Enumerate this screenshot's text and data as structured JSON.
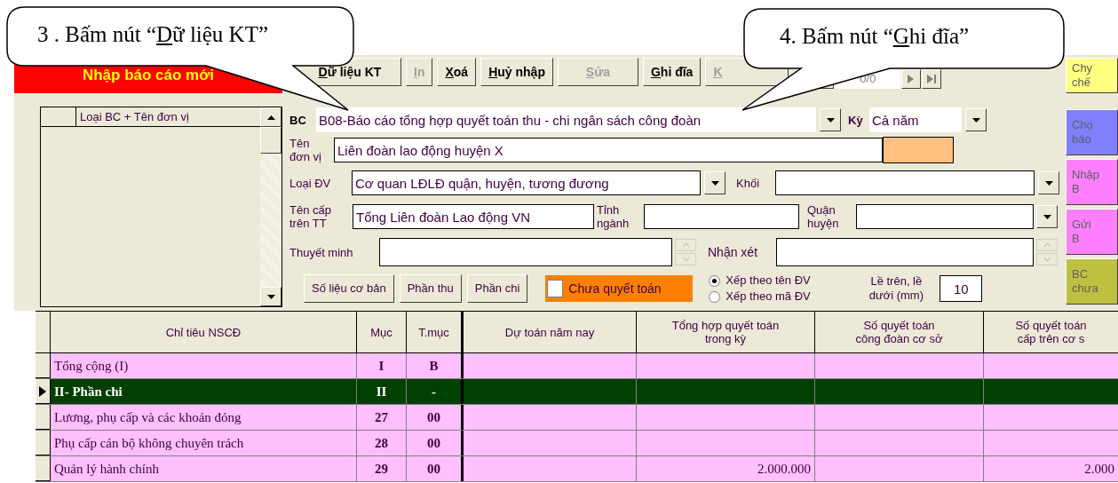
{
  "callouts": [
    {
      "pre": "3 . Bấm nút “",
      "key": "D",
      "post": "ữ liệu KT”"
    },
    {
      "pre": "4. Bấm nút “",
      "key": "G",
      "post": "hi đĩa”"
    }
  ],
  "banner": "Nhập báo cáo mới",
  "toolbar": [
    {
      "key": "D",
      "rest": "ữ liệu KT",
      "disabled": false
    },
    {
      "key": "I",
      "rest": "n",
      "disabled": true
    },
    {
      "key": "X",
      "rest": "oá",
      "disabled": false
    },
    {
      "key": "H",
      "rest": "uỷ nhập",
      "disabled": false
    },
    {
      "key": "S",
      "rest": "ửa",
      "disabled": true
    },
    {
      "key": "G",
      "rest": "hi đĩa",
      "disabled": false
    },
    {
      "key": "K",
      "disabled": true
    }
  ],
  "navigator": {
    "position": "0/0"
  },
  "side_buttons": [
    {
      "label": "Chy chế",
      "color": "#ffff80"
    },
    {
      "label": "Chọ báo",
      "color": "#8080ff"
    },
    {
      "label": "Nhập B",
      "color": "#ff80ff"
    },
    {
      "label": "Gửi B",
      "color": "#ff80ff"
    },
    {
      "label": "BC chưa",
      "color": "#c0c040"
    }
  ],
  "list_panel": {
    "header": "Loại BC + Tên đơn vị"
  },
  "form": {
    "bc": {
      "label": "BC",
      "value": "B08-Báo cáo tổng hợp quyết toán thu - chi ngân sách công đoàn"
    },
    "ky": {
      "label": "Kỳ",
      "value": "Cả năm"
    },
    "ten_don_vi": {
      "label": "Tên đơn vị",
      "value": "Liên đoàn lao động huyện X"
    },
    "loai_dv": {
      "label": "Loại ĐV",
      "value": "Cơ quan LĐLĐ quận, huyện, tương đương"
    },
    "khoi": {
      "label": "Khối"
    },
    "ten_cap_tren": {
      "label": "Tên cấp trên TT",
      "value": "Tổng Liên đoàn Lao động VN"
    },
    "tinh_nganh": {
      "label": "Tỉnh ngành"
    },
    "quan_huyen": {
      "label": "Quận huyện"
    },
    "thuyet_minh": {
      "label": "Thuyết minh"
    },
    "nhan_xet": {
      "label": "Nhận xét"
    },
    "sections": [
      "Số liệu cơ bản",
      "Phần thu",
      "Phần chi"
    ],
    "chua_quyet_toan": {
      "label": "Chưa quyết toán",
      "checked": false
    },
    "sort": [
      {
        "label": "Xếp theo tên ĐV",
        "selected": true
      },
      {
        "label": "Xếp theo mã ĐV",
        "selected": false
      }
    ],
    "margin": {
      "label": "Lề trên, lề dưới (mm)",
      "value": "10"
    }
  },
  "grid": {
    "columns": [
      {
        "lines": [
          "Chỉ tiêu NSCĐ"
        ]
      },
      {
        "lines": [
          "Mục"
        ]
      },
      {
        "lines": [
          "T.mục"
        ]
      },
      {
        "lines": [
          "Dự toán năm nay"
        ]
      },
      {
        "lines": [
          "Tổng hợp quyết toán",
          "trong kỳ"
        ]
      },
      {
        "lines": [
          "Số quyết toán",
          "công đoàn cơ sở"
        ]
      },
      {
        "lines": [
          "Số quyết toán",
          "cấp trên cơ s"
        ]
      }
    ],
    "rows": [
      {
        "name": "Tổng cộng (I)",
        "muc": "I",
        "tmuc": "B",
        "selected": false
      },
      {
        "name": "II- Phần chi",
        "muc": "II",
        "tmuc": "-",
        "selected": true
      },
      {
        "name": "Lương, phụ cấp và các khoản đóng",
        "muc": "27",
        "tmuc": "00",
        "selected": false
      },
      {
        "name": "Phụ cấp cán bộ không chuyên trách",
        "muc": "28",
        "tmuc": "00",
        "selected": false
      },
      {
        "name": "Quản lý hành chính",
        "muc": "29",
        "tmuc": "00",
        "selected": false,
        "tong_hop": "2.000.000",
        "so_cap_tren": "2.000"
      }
    ]
  }
}
